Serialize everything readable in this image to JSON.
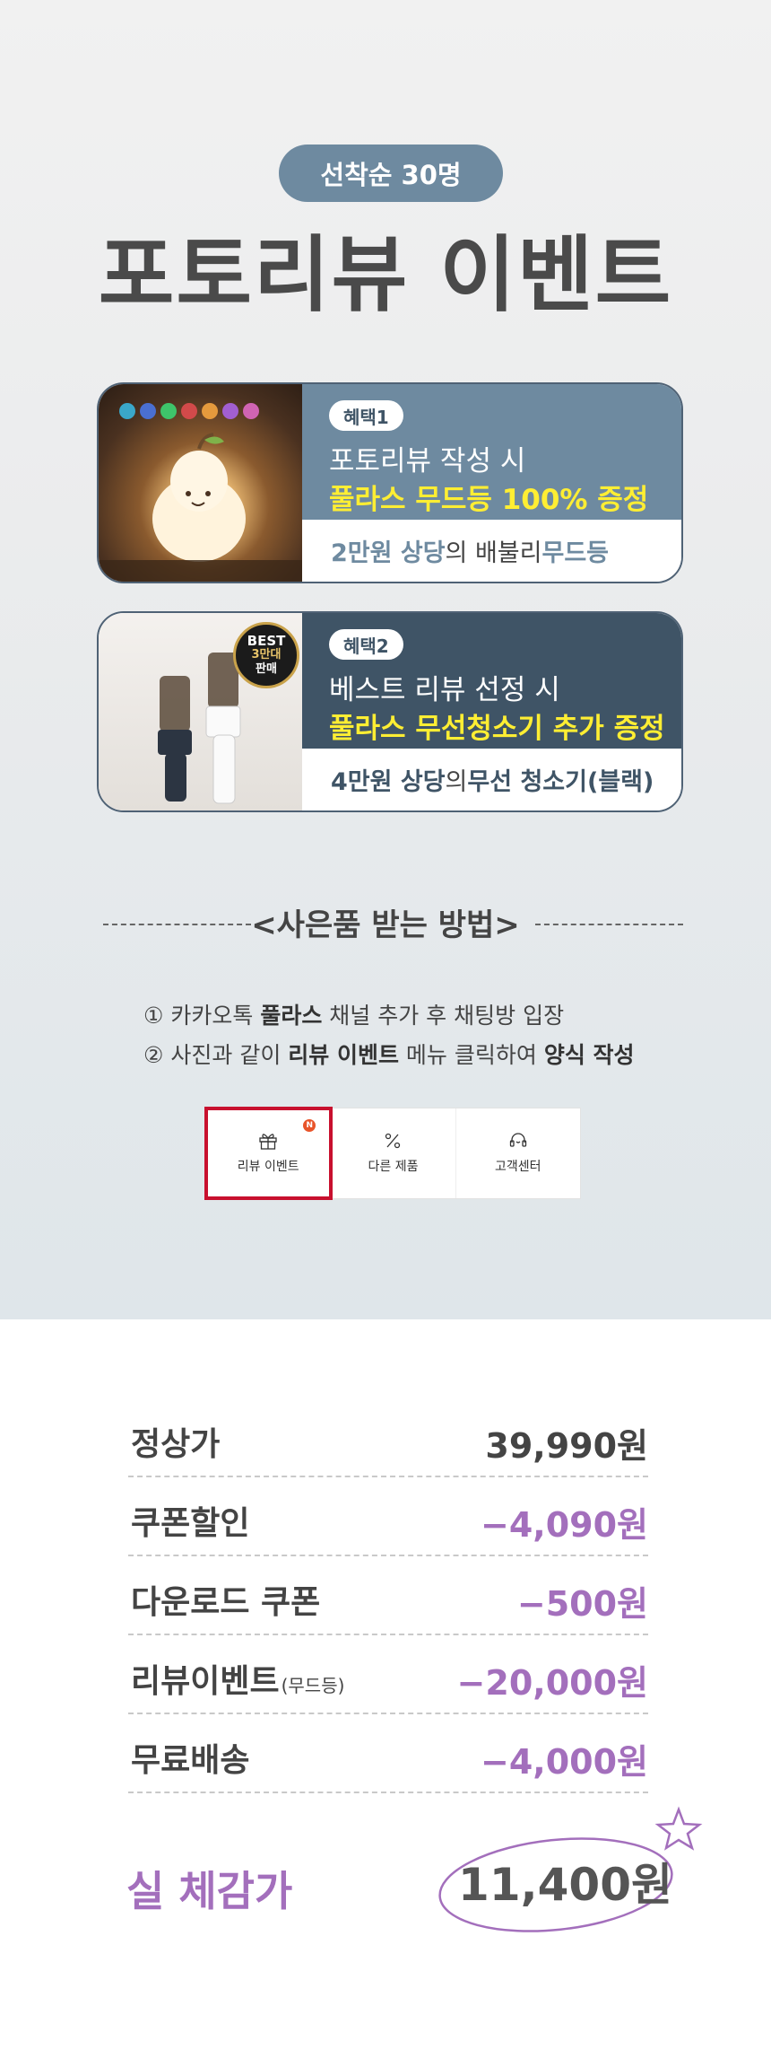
{
  "header": {
    "pill_label": "선착순 30명",
    "title": "포토리뷰 이벤트"
  },
  "benefits": [
    {
      "badge": "혜택1",
      "line1": "포토리뷰 작성 시",
      "line2": "풀라스 무드등 100% 증정",
      "sub_value": "2만원 상당",
      "sub_middle": "의 배불리 ",
      "sub_item": "무드등"
    },
    {
      "badge": "혜택2",
      "line1": "베스트 리뷰 선정 시",
      "line2": "풀라스 무선청소기 추가 증정",
      "sub_value": "4만원 상당",
      "sub_middle": "의 ",
      "sub_item": "무선 청소기(블랙)",
      "best_seal": [
        "BEST",
        "3만대",
        "판매"
      ]
    }
  ],
  "howto": {
    "title": "<사은품 받는 방법>",
    "step1": {
      "num": "①",
      "pre": " 카카오톡 ",
      "bold": "풀라스",
      "post": " 채널 추가 후 채팅방 입장"
    },
    "step2": {
      "num": "②",
      "pre": " 사진과 같이 ",
      "bold1": "리뷰 이벤트",
      "mid": " 메뉴 클릭하여 ",
      "bold2": "양식 작성"
    }
  },
  "menu": {
    "items": [
      {
        "label": "리뷰 이벤트",
        "icon": "gift-icon",
        "new": "N"
      },
      {
        "label": "다른 제품",
        "icon": "percent-icon"
      },
      {
        "label": "고객센터",
        "icon": "headset-icon"
      }
    ]
  },
  "prices": {
    "rows": [
      {
        "label": "정상가",
        "label_small": "",
        "value": "39,990원"
      },
      {
        "label": "쿠폰할인",
        "label_small": "",
        "value": "−4,090원"
      },
      {
        "label": "다운로드 쿠폰",
        "label_small": "",
        "value": "−500원"
      },
      {
        "label": "리뷰이벤트",
        "label_small": "(무드등)",
        "value": "−20,000원"
      },
      {
        "label": "무료배송",
        "label_small": "",
        "value": "−4,000원"
      }
    ],
    "final_label": "실 체감가",
    "final_value": "11,400원"
  },
  "colors": {
    "accent_blue": "#6e8aa0",
    "dark_blue": "#3f5466",
    "yellow": "#ffee33",
    "purple": "#a36fbc",
    "highlight_red": "#c8102e"
  }
}
